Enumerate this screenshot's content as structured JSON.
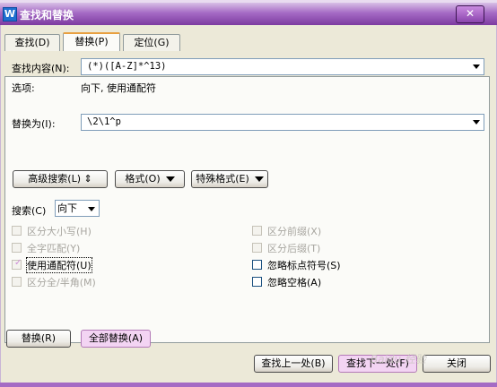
{
  "window": {
    "title": "查找和替换",
    "app_icon": "W",
    "close_label": "✕"
  },
  "tabs": [
    {
      "label": "查找(D)",
      "active": false
    },
    {
      "label": "替换(P)",
      "active": true
    },
    {
      "label": "定位(G)",
      "active": false
    }
  ],
  "find": {
    "label": "查找内容(N):",
    "value": "(*)([A-Z]*^13)"
  },
  "options": {
    "label": "选项:",
    "value": "向下, 使用通配符"
  },
  "replace": {
    "label": "替换为(I):",
    "value": "\\2\\1^p"
  },
  "buttons": {
    "advanced": "高级搜索(L) ⇕",
    "format": "格式(O)",
    "special": "特殊格式(E)"
  },
  "search": {
    "label": "搜索(C)",
    "value": "向下"
  },
  "checkboxes_left": [
    {
      "label": "区分大小写(H)",
      "checked": false,
      "enabled": false
    },
    {
      "label": "全字匹配(Y)",
      "checked": false,
      "enabled": false
    },
    {
      "label": "使用通配符(U)",
      "checked": true,
      "enabled": true
    },
    {
      "label": "区分全/半角(M)",
      "checked": false,
      "enabled": false
    }
  ],
  "checkboxes_right": [
    {
      "label": "区分前缀(X)",
      "checked": false,
      "enabled": false
    },
    {
      "label": "区分后缀(T)",
      "checked": false,
      "enabled": false
    },
    {
      "label": "忽略标点符号(S)",
      "checked": false,
      "enabled": true
    },
    {
      "label": "忽略空格(A)",
      "checked": false,
      "enabled": true
    }
  ],
  "actions": {
    "replace": "替换(R)",
    "replace_all": "全部替换(A)",
    "find_prev": "查找上一处(B)",
    "find_next": "查找下一处(F)",
    "close": "关闭"
  },
  "watermark": "Baidu 经验"
}
